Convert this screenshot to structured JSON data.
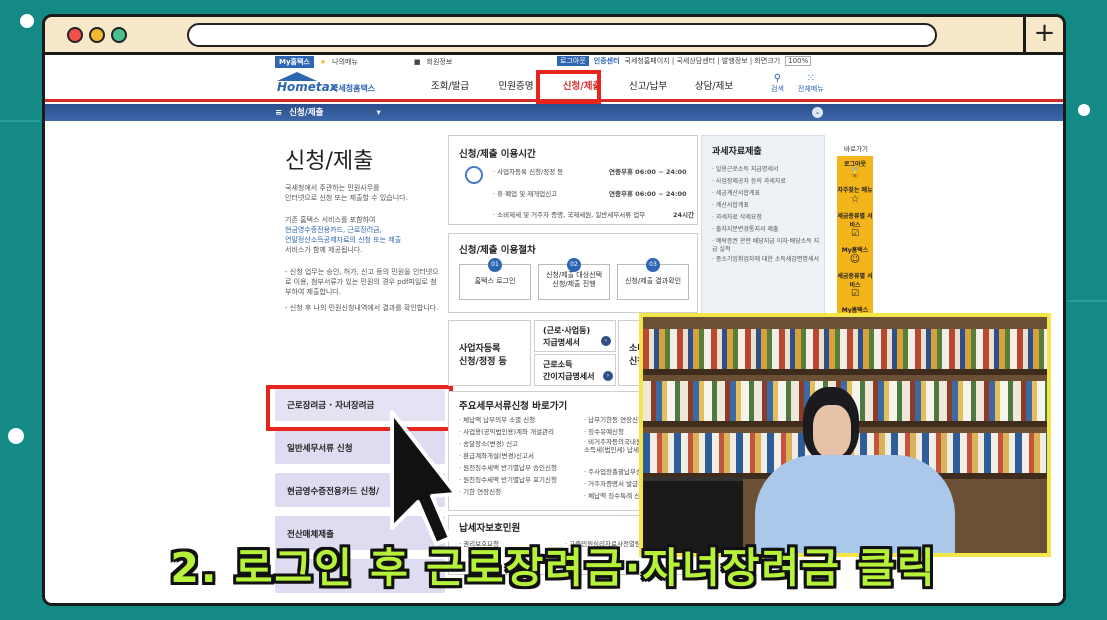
{
  "colors": {
    "background": "#138a86",
    "accent_red": "#e8241d",
    "brand_blue": "#2f66b3",
    "caption_green": "#b7f23a",
    "quick_yellow": "#f3b51a"
  },
  "utility": {
    "myhome": "My홈택스",
    "favorites": "나의메뉴",
    "member": "회원정보",
    "login": "로그아웃",
    "cert": "인증센터",
    "links": "국세청홈페이지 | 국세상담센터 | 발행정보 | 화면크기",
    "zoom": "100%"
  },
  "logo": {
    "brand": "Hometax",
    "name": "국세청홈택스"
  },
  "nav": [
    "조회/발급",
    "민원증명",
    "신청/제출",
    "신고/납부",
    "상담/제보"
  ],
  "nav_icons": {
    "search": "검색",
    "all": "전체메뉴"
  },
  "breadcrumb": "신청/제출",
  "page_title": "신청/제출",
  "desc": {
    "p1_l1": "국세청에서 주관하는 민원사무를",
    "p1_l2": "인터넷으로 신청 또는 제출할 수 있습니다.",
    "p2_l1": "기존 홈택스 서비스를 포함하여",
    "p2_l2": "현금영수증전용카드, 근로장려금,",
    "p2_l3": "연말정산소득공제자료의 신청 또는 제출",
    "p2_l4": "서비스가 함께 제공됩니다.",
    "b1_l1": "- 신청 업무는 승인, 허가, 신고 등의 민원을 인터넷으",
    "b1_l2": "로 이용, 첨부서류가 있는 민원의 경우 pdf파일로 첨",
    "b1_l3": "부하여 제출합니다.",
    "b2": "- 신청 후 나의 민원신청내역에서 결과를 확인합니다."
  },
  "left_menu": [
    "근로장려금 · 자녀장려금",
    "일반세무서류 신청",
    "현금영수증전용카드 신청/",
    "전산매체제출"
  ],
  "hours": {
    "title": "신청/제출 이용시간",
    "r1_label": "· 사업자등록 신청/정정 등",
    "r1_time": "연중무휴 06:00 ~ 24:00",
    "r2_label": "· 휴·폐업 및 재개업신고",
    "r2_time": "연중무휴 06:00 ~ 24:00",
    "r3_label": "· 소비제세 및 거주자 증명, 국제세원, 일반세무서류 업무",
    "r3_time": "24시간"
  },
  "procedure": {
    "title": "신청/제출 이용절차",
    "steps": [
      {
        "num": "01",
        "label": "홈택스 로그인"
      },
      {
        "num": "02",
        "label": "신청/제출 대상선택 신청/제출 진행"
      },
      {
        "num": "03",
        "label": "신청/제출 결과확인"
      }
    ]
  },
  "tiles": {
    "t1_l1": "사업자등록",
    "t1_l2": "신청/정정 등",
    "t2_l1": "(근로·사업등)",
    "t2_l2": "지급명세서",
    "t3_l1": "근로소득",
    "t3_l2": "간이지급명세서",
    "t4_l1": "소비제세",
    "t4_l2": "신청/제출"
  },
  "shortcuts": {
    "title": "주요세무서류신청 바로가기",
    "col1": [
      "· 체납액 납부의무 소멸 신청",
      "· 사업용(공익법인용)계좌 개설관리",
      "· 송달장소(변경) 신고",
      "· 환급계좌개설(변경)신고서",
      "· 원천징수세액 반기별납부 승인신청",
      "· 원천징수세액 반기별납부 포기신청",
      "· 기한 연장신청"
    ],
    "col2": [
      "· 납부기한등 연장신청",
      "· 징수유예신청",
      "· 비거주자등의국내원천소득에 대한 소득세(법인세) 납세사실 증명",
      "· 주사업장총괄납부승인변경신청",
      "· 거주자증명서 발급신청서",
      "· 체납액 징수특례 신청"
    ]
  },
  "protection": {
    "title": "납세자보호민원",
    "i1": "· 권리보호요청",
    "i2": "· 고충민원심리자료사전열람"
  },
  "side_panel": {
    "title": "과세자료제출",
    "items": [
      "· 일용근로소득 지급명세서",
      "· 사업장제공자 등의 과세자료",
      "· 세금계산서합계표",
      "· 계산서합계표",
      "· 과세자료 삭제요청",
      "· 출자지분변경통지서 제출",
      "· 예탁증권 관련 배당지급 이자·배당소득 지급 실적",
      "· 중소기업취업자에 대한 소득세감면명세서"
    ]
  },
  "quick": {
    "title": "바로가기",
    "items": [
      "로그아웃",
      "자주찾는 메뉴",
      "세금종류별 서비스",
      "My홈택스",
      "세금종류별 서비스",
      "My홈택스"
    ]
  },
  "caption": "2. 로그인 후 근로장려금·자녀장려금 클릭"
}
